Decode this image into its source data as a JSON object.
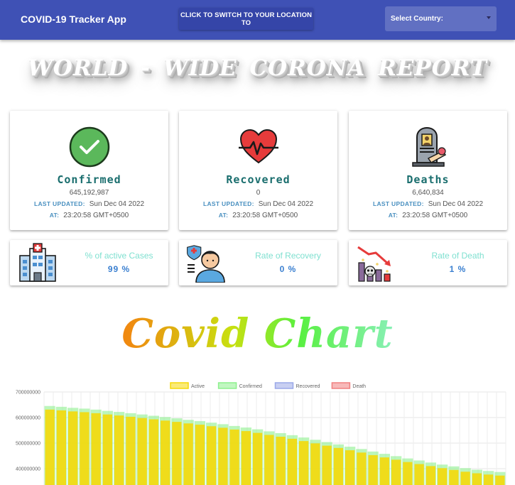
{
  "appbar": {
    "title": "COVID-19 Tracker App",
    "location_button": "CLICK TO SWITCH TO YOUR LOCATION TO",
    "country_select": {
      "label": "Select Country:"
    },
    "color": "#3f51b5"
  },
  "headline": "WORLD - WIDE   CORONA REPORT",
  "stats": [
    {
      "title": "Confirmed",
      "icon": "check-circle-icon",
      "value": "645,192,987",
      "updated_label": "LAST UPDATED:",
      "updated": "Sun Dec 04 2022",
      "at_label": "AT:",
      "at": "23:20:58 GMT+0500"
    },
    {
      "title": "Recovered",
      "icon": "heartbeat-icon",
      "value": "0",
      "updated_label": "LAST UPDATED:",
      "updated": "Sun Dec 04 2022",
      "at_label": "AT:",
      "at": "23:20:58 GMT+0500"
    },
    {
      "title": "Deaths",
      "icon": "gravestone-icon",
      "value": "6,640,834",
      "updated_label": "LAST UPDATED:",
      "updated": "Sun Dec 04 2022",
      "at_label": "AT:",
      "at": "23:20:58 GMT+0500"
    }
  ],
  "rates": [
    {
      "title": "% of active Cases",
      "value": "99 %",
      "icon": "hospital-icon"
    },
    {
      "title": "Rate of Recovery",
      "value": "0 %",
      "icon": "doctor-icon"
    },
    {
      "title": "Rate of Death",
      "value": "1 %",
      "icon": "death-chart-icon"
    }
  ],
  "chart_title": "Covid Chart",
  "chart_data": {
    "type": "bar",
    "legend": [
      "Active",
      "Confirmed",
      "Recovered",
      "Death"
    ],
    "legend_colors": [
      "#f5d90a",
      "#8ef08e",
      "#9aa8e8",
      "#f08080"
    ],
    "legend_placement": "top",
    "yticks": [
      "700000000",
      "600000000",
      "500000000",
      "400000000"
    ],
    "ylim_visible": [
      370000000,
      700000000
    ],
    "grid": true,
    "series": [
      {
        "name": "Active",
        "color": "#f5d90a",
        "values": [
          631000000,
          628000000,
          624000000,
          621000000,
          617000000,
          612000000,
          608000000,
          603000000,
          598000000,
          593000000,
          588000000,
          583000000,
          577000000,
          572000000,
          566000000,
          560000000,
          553000000,
          547000000,
          540000000,
          532000000,
          525000000,
          517000000,
          508000000,
          499000000,
          490000000,
          481000000,
          472000000,
          463000000,
          453000000,
          444000000,
          435000000,
          426000000,
          418000000,
          410000000,
          402000000,
          395000000,
          388000000,
          382000000,
          377000000,
          373000000
        ]
      },
      {
        "name": "Confirmed",
        "color": "#8ef08e",
        "values": [
          645192987,
          642000000,
          638000000,
          635000000,
          631000000,
          626000000,
          622000000,
          617000000,
          612000000,
          607000000,
          602000000,
          597000000,
          591000000,
          586000000,
          580000000,
          574000000,
          567000000,
          561000000,
          554000000,
          546000000,
          539000000,
          531000000,
          522000000,
          513000000,
          504000000,
          495000000,
          486000000,
          477000000,
          467000000,
          458000000,
          449000000,
          440000000,
          432000000,
          424000000,
          416000000,
          409000000,
          402000000,
          396000000,
          391000000,
          387000000
        ]
      }
    ]
  }
}
